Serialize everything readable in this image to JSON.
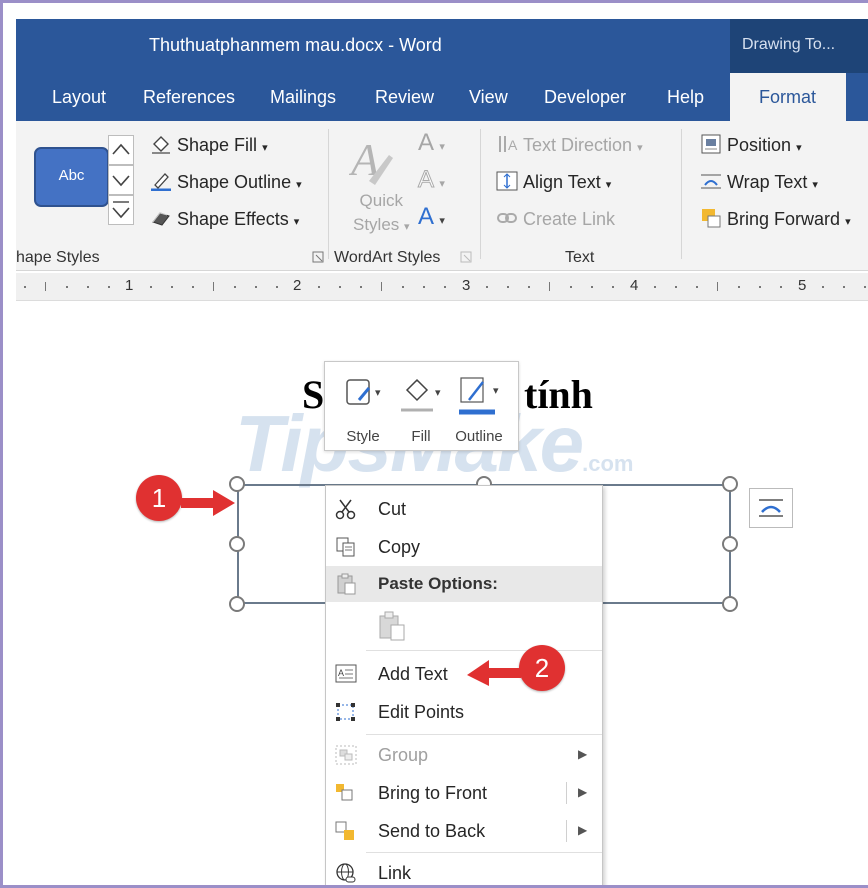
{
  "window": {
    "doc_title": "Thuthuatphanmem mau.docx  -  Word",
    "context_tab": "Drawing To..."
  },
  "tabs": [
    "Layout",
    "References",
    "Mailings",
    "Review",
    "View",
    "Developer",
    "Help",
    "Format"
  ],
  "active_tab": "Format",
  "ribbon": {
    "shape_styles": {
      "sample_label": "Abc",
      "shape_fill": "Shape Fill",
      "shape_outline": "Shape Outline",
      "shape_effects": "Shape Effects",
      "group_label": "hape Styles"
    },
    "wordart": {
      "quick_styles_line1": "Quick",
      "quick_styles_line2": "Styles",
      "group_label": "WordArt Styles"
    },
    "text": {
      "text_direction": "Text Direction",
      "align_text": "Align Text",
      "create_link": "Create Link",
      "group_label": "Text"
    },
    "arrange": {
      "position": "Position",
      "wrap_text": "Wrap Text",
      "bring_forward": "Bring Forward"
    }
  },
  "ruler": {
    "numbers": [
      "1",
      "2",
      "3",
      "4",
      "5"
    ]
  },
  "document": {
    "heading_left": "S",
    "heading_right": "tính"
  },
  "watermark": {
    "brand": "TipsMake",
    "suffix": ".com"
  },
  "mini_toolbar": {
    "style": "Style",
    "fill": "Fill",
    "outline": "Outline"
  },
  "context_menu": {
    "cut": "Cut",
    "copy": "Copy",
    "paste_options": "Paste Options:",
    "add_text": "Add Text",
    "edit_points": "Edit Points",
    "group": "Group",
    "bring_to_front": "Bring to Front",
    "send_to_back": "Send to Back",
    "link": "Link"
  },
  "callouts": {
    "one": "1",
    "two": "2"
  },
  "colors": {
    "word_blue": "#2b579a",
    "callout_red": "#e03131",
    "shape_blue": "#4472c4"
  }
}
